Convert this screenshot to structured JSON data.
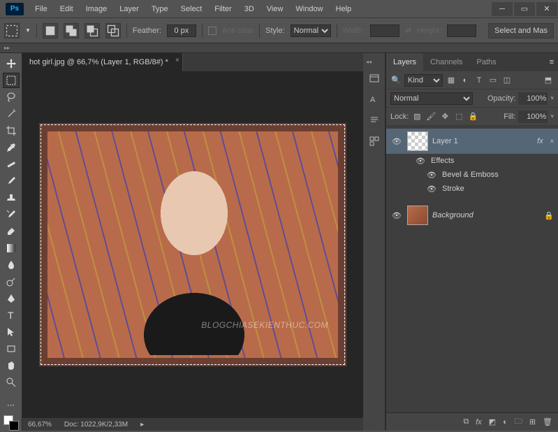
{
  "menus": [
    "File",
    "Edit",
    "Image",
    "Layer",
    "Type",
    "Select",
    "Filter",
    "3D",
    "View",
    "Window",
    "Help"
  ],
  "options": {
    "feather_label": "Feather:",
    "feather_value": "0 px",
    "antialias": "Anti-alias",
    "style_label": "Style:",
    "style_value": "Normal",
    "width_label": "Width:",
    "height_label": "Height:",
    "right_button": "Select and Mas"
  },
  "doc": {
    "tab_title": "hot girl.jpg @ 66,7% (Layer 1, RGB/8#) *",
    "watermark": "BLOGCHIASEKIENTHUC.COM"
  },
  "status": {
    "zoom": "66,67%",
    "doc": "Doc: 1022,9K/2,33M"
  },
  "panels": {
    "tabs": [
      "Layers",
      "Channels",
      "Paths"
    ],
    "filter_kind": "Kind",
    "blend": "Normal",
    "opacity_label": "Opacity:",
    "opacity_value": "100%",
    "lock_label": "Lock:",
    "fill_label": "Fill:",
    "fill_value": "100%",
    "layers": [
      {
        "name": "Layer 1",
        "fx": true,
        "effects_label": "Effects",
        "fx_items": [
          "Bevel & Emboss",
          "Stroke"
        ],
        "bg": false,
        "locked": false
      },
      {
        "name": "Background",
        "fx": false,
        "bg": true,
        "locked": true
      }
    ]
  }
}
